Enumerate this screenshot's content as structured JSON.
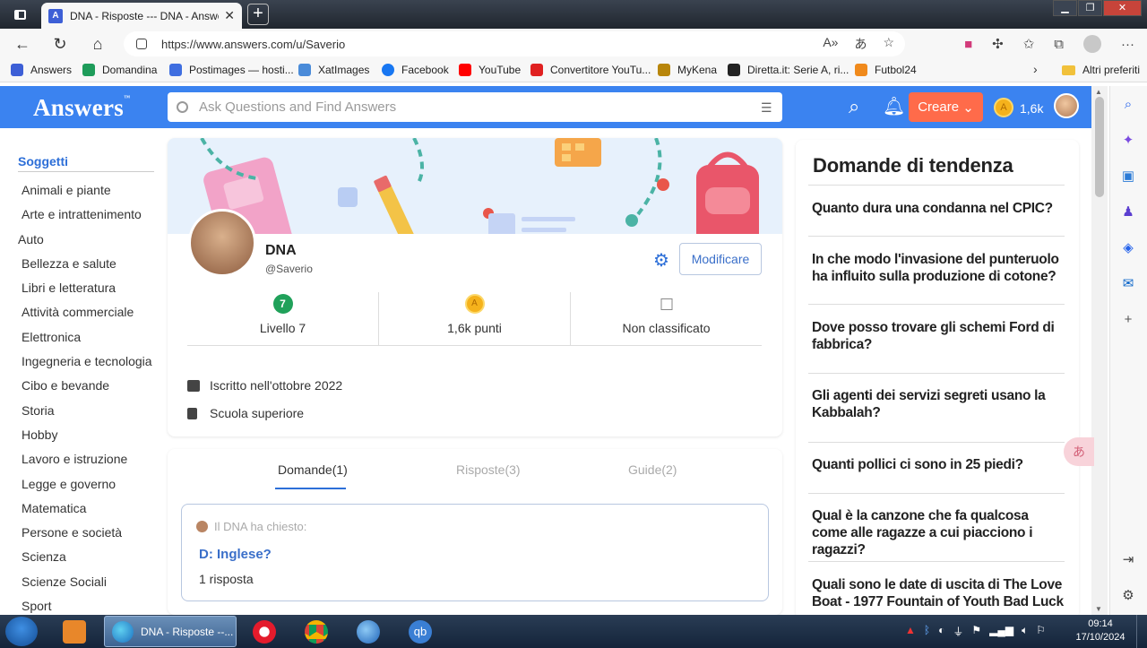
{
  "browser": {
    "tab_title": "DNA - Risposte --- DNA - Answers",
    "tab_favicon": "A",
    "url": "https://www.answers.com/u/Saverio",
    "bookmarks": [
      {
        "label": "Answers",
        "color": "#3d5fd6"
      },
      {
        "label": "Domandina",
        "color": "#1e9c5a"
      },
      {
        "label": "Postimages — hosti...",
        "color": "#3f6ee0"
      },
      {
        "label": "XatImages",
        "color": "#4a8bd9"
      },
      {
        "label": "Facebook",
        "color": "#1877f2"
      },
      {
        "label": "YouTube",
        "color": "#ff0000"
      },
      {
        "label": "Convertitore YouTu...",
        "color": "#e02020"
      },
      {
        "label": "MyKena",
        "color": "#b8860b"
      },
      {
        "label": "Diretta.it: Serie A, ri...",
        "color": "#222222"
      },
      {
        "label": "Futbol24",
        "color": "#f08a1c"
      }
    ],
    "other_favorites": "Altri preferiti"
  },
  "site": {
    "logo": "Answers",
    "search_placeholder": "Ask Questions and Find Answers",
    "create_label": "Creare",
    "points": "1,6k",
    "brand_color": "#3b83f0",
    "accent_color": "#ff6b4a"
  },
  "sidebar": {
    "heading": "Soggetti",
    "items": [
      "Animali e piante",
      "Arte e intrattenimento",
      "Auto",
      "Bellezza e salute",
      "Libri e letteratura",
      "Attività commerciale",
      "Elettronica",
      "Ingegneria e tecnologia",
      "Cibo e bevande",
      "Storia",
      "Hobby",
      "Lavoro e istruzione",
      "Legge e governo",
      "Matematica",
      "Persone e società",
      "Scienza",
      "Scienze Sociali",
      "Sport"
    ]
  },
  "profile": {
    "name": "DNA",
    "handle": "@Saverio",
    "edit_label": "Modificare",
    "level_number": "7",
    "level_label": "Livello 7",
    "points_label": "1,6k punti",
    "rank_label": "Non classificato",
    "joined": "Iscritto nell'ottobre 2022",
    "school": "Scuola superiore"
  },
  "content_tabs": {
    "questions": "Domande(1)",
    "answers": "Risposte(3)",
    "guides": "Guide(2)"
  },
  "question": {
    "asked_by": "Il DNA ha chiesto:",
    "title": "D: Inglese?",
    "answer_count": "1 risposta"
  },
  "trending": {
    "heading": "Domande di tendenza",
    "items": [
      "Quanto dura una condanna nel CPIC?",
      "In che modo l'invasione del punteruolo ha influito sulla produzione di cotone?",
      "Dove posso trovare gli schemi Ford di fabbrica?",
      "Gli agenti dei servizi segreti usano la Kabbalah?",
      "Quanti pollici ci sono in 25 piedi?",
      "Qual è la canzone che fa qualcosa come alle ragazze a cui piacciono i ragazzi?",
      "Quali sono le date di uscita di The Love Boat - 1977 Fountain of Youth Bad Luck"
    ]
  },
  "taskbar": {
    "active_window": "DNA - Risposte --...",
    "time": "09:14",
    "date": "17/10/2024"
  }
}
